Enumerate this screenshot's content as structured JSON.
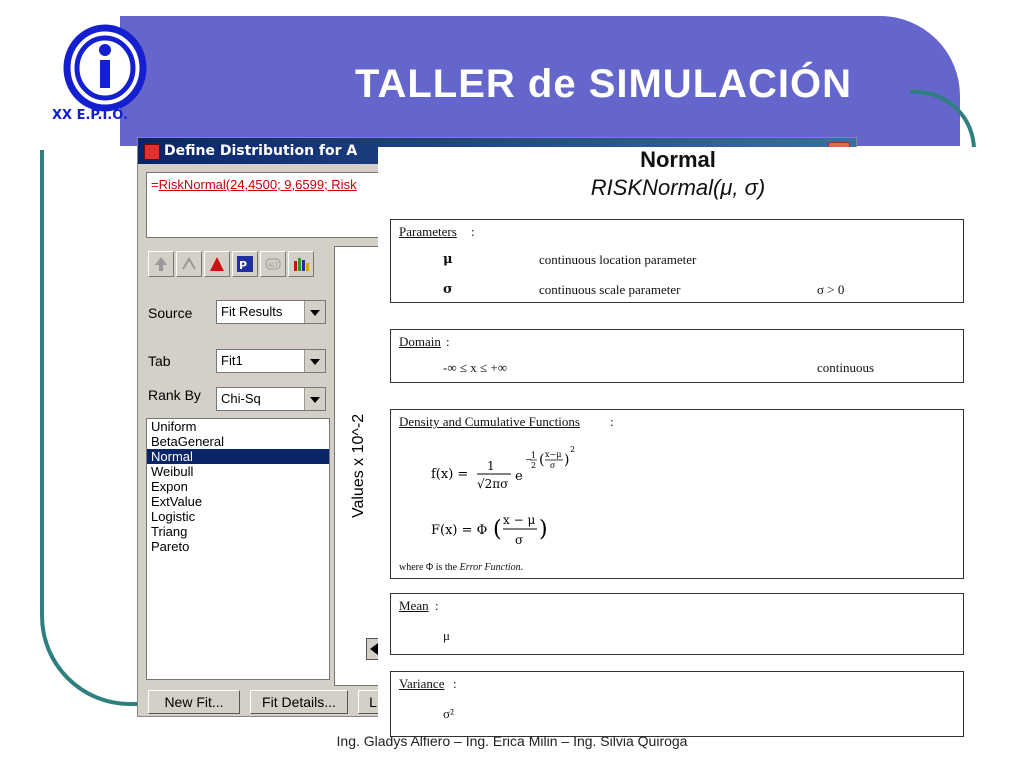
{
  "slide": {
    "title": "TALLER de SIMULACIÓN",
    "logo_text": "XX E.P.I.O.",
    "footer": "Ing. Gladys Alfiero – Ing. Erica Milin – Ing. Silvia Quiroga"
  },
  "dialog": {
    "title": "Define Distribution for A",
    "formula_prefix": "=",
    "formula_link": "RiskNormal(24,4500; 9,6599; Risk",
    "toolbar_icons": [
      "arrow-up-icon",
      "pointer-icon",
      "triangle-icon",
      "p0-icon",
      "alt-icon",
      "bar-chart-icon"
    ],
    "source": {
      "label": "Source",
      "value": "Fit Results"
    },
    "tab": {
      "label": "Tab",
      "value": "Fit1"
    },
    "rank_by": {
      "label": "Rank By",
      "value": "Chi-Sq"
    },
    "distributions": [
      "Uniform",
      "BetaGeneral",
      "Normal",
      "Weibull",
      "Expon",
      "ExtValue",
      "Logistic",
      "Triang",
      "Pareto"
    ],
    "selected_distribution": "Normal",
    "y_axis_label": "Values x 10^-2",
    "buttons": {
      "new_fit": "New Fit...",
      "fit_details": "Fit Details...",
      "third": "L"
    }
  },
  "help": {
    "title": "Normal",
    "subtitle": "RISKNormal(μ, σ)",
    "parameters": {
      "heading": "Parameters",
      "mu_symbol": "μ",
      "mu_desc": "continuous location parameter",
      "sigma_symbol": "σ",
      "sigma_desc": "continuous scale parameter",
      "sigma_constraint": "σ > 0"
    },
    "domain": {
      "heading": "Domain",
      "range": "-∞ ≤ x ≤ +∞",
      "kind": "continuous"
    },
    "density": {
      "heading": "Density and Cumulative Functions",
      "note_prefix": "where Φ is the ",
      "note_em": "Error Function",
      "note_suffix": "."
    },
    "mean": {
      "heading": "Mean",
      "value": "μ"
    },
    "variance": {
      "heading": "Variance",
      "value": "σ²"
    }
  }
}
